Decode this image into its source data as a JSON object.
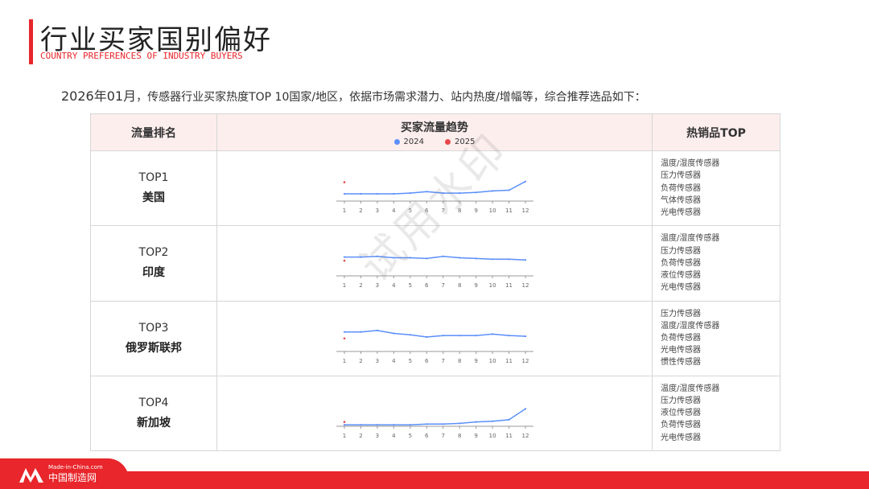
{
  "header": {
    "title": "行业买家国别偏好",
    "subtitle": "COUNTRY PREFERENCES OF INDUSTRY BUYERS"
  },
  "intro": {
    "date": "2026年01月",
    "text": "，传感器行业买家热度TOP 10国家/地区，依据市场需求潜力、站内热度/增幅等，综合推荐选品如下："
  },
  "table": {
    "headers": {
      "rank": "流量排名",
      "trend": "买家流量趋势",
      "products": "热销品TOP"
    },
    "legend": [
      {
        "name": "2024",
        "color": "#5b8ff9"
      },
      {
        "name": "2025",
        "color": "#e8484b"
      }
    ],
    "rows": [
      {
        "rank": "TOP1",
        "country": "美国",
        "products": [
          "温度/湿度传感器",
          "压力传感器",
          "负荷传感器",
          "气体传感器",
          "光电传感器"
        ]
      },
      {
        "rank": "TOP2",
        "country": "印度",
        "products": [
          "温度/湿度传感器",
          "压力传感器",
          "负荷传感器",
          "液位传感器",
          "光电传感器"
        ]
      },
      {
        "rank": "TOP3",
        "country": "俄罗斯联邦",
        "products": [
          "压力传感器",
          "温度/湿度传感器",
          "负荷传感器",
          "光电传感器",
          "惯性传感器"
        ]
      },
      {
        "rank": "TOP4",
        "country": "新加坡",
        "products": [
          "温度/湿度传感器",
          "压力传感器",
          "液位传感器",
          "负荷传感器",
          "光电传感器"
        ]
      }
    ]
  },
  "chart_data": [
    {
      "type": "line",
      "x": [
        "1",
        "2",
        "3",
        "4",
        "5",
        "6",
        "7",
        "8",
        "9",
        "10",
        "11",
        "12"
      ],
      "ylim": [
        0,
        40
      ],
      "series": [
        {
          "name": "2024",
          "color": "#5b8ff9",
          "values": [
            10,
            10,
            10,
            10,
            11,
            13,
            11,
            11,
            12,
            14,
            15,
            27
          ]
        },
        {
          "name": "2025",
          "color": "#e8484b",
          "values": [
            26
          ]
        }
      ]
    },
    {
      "type": "line",
      "x": [
        "1",
        "2",
        "3",
        "4",
        "5",
        "6",
        "7",
        "8",
        "9",
        "10",
        "11",
        "12"
      ],
      "ylim": [
        0,
        40
      ],
      "series": [
        {
          "name": "2024",
          "color": "#5b8ff9",
          "values": [
            26,
            26,
            27,
            25,
            25,
            24,
            27,
            25,
            24,
            23,
            23,
            22
          ]
        },
        {
          "name": "2025",
          "color": "#e8484b",
          "values": [
            21
          ]
        }
      ]
    },
    {
      "type": "line",
      "x": [
        "1",
        "2",
        "3",
        "4",
        "5",
        "6",
        "7",
        "8",
        "9",
        "10",
        "11",
        "12"
      ],
      "ylim": [
        0,
        40
      ],
      "series": [
        {
          "name": "2024",
          "color": "#5b8ff9",
          "values": [
            27,
            27,
            29,
            25,
            23,
            20,
            22,
            22,
            22,
            24,
            22,
            21
          ]
        },
        {
          "name": "2025",
          "color": "#e8484b",
          "values": [
            18
          ]
        }
      ]
    },
    {
      "type": "line",
      "x": [
        "1",
        "2",
        "3",
        "4",
        "5",
        "6",
        "7",
        "8",
        "9",
        "10",
        "11",
        "12"
      ],
      "ylim": [
        0,
        40
      ],
      "series": [
        {
          "name": "2024",
          "color": "#5b8ff9",
          "values": [
            2,
            2,
            2,
            2,
            2,
            3,
            3,
            4,
            6,
            7,
            9,
            24
          ]
        },
        {
          "name": "2025",
          "color": "#e8484b",
          "values": [
            6
          ]
        }
      ]
    }
  ],
  "watermark": "试用水印",
  "footer": {
    "logo_en": "Made-in-China.com",
    "logo_cn": "中国制造网"
  }
}
